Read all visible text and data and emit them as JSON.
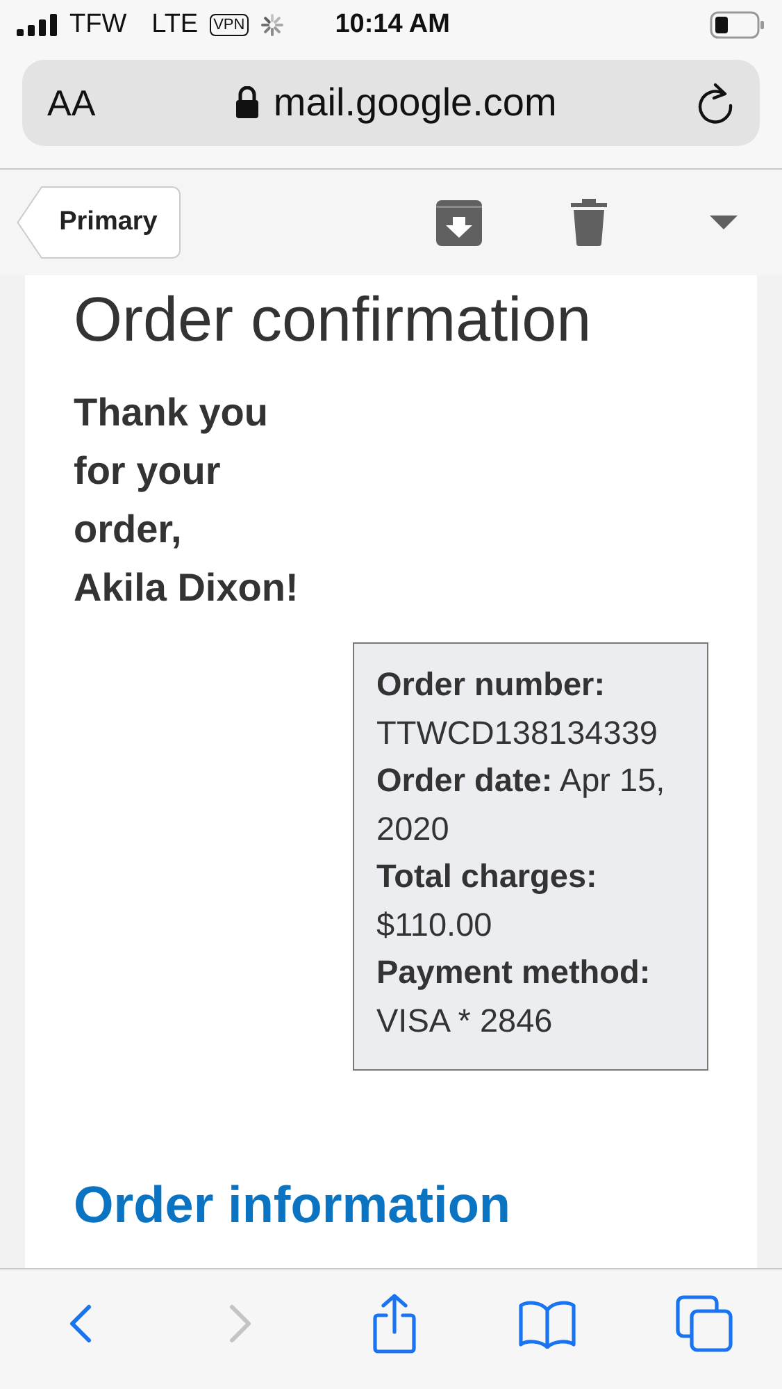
{
  "status_bar": {
    "carrier": "TFW",
    "network": "LTE",
    "vpn": "VPN",
    "time": "10:14 AM"
  },
  "address_bar": {
    "text_size": "AA",
    "url": "mail.google.com"
  },
  "mail_toolbar": {
    "back_label": "Primary"
  },
  "email": {
    "title": "Order confirmation",
    "greeting_lines": [
      "Thank you",
      "for your",
      "order,",
      "Akila Dixon!"
    ],
    "details": [
      "**Order number:** TTWCD138134339",
      "**Order date:** Apr 15, 2020",
      "**Total charges:** $110.00",
      "**Payment method:** VISA * 2846"
    ],
    "section_title": "Order information"
  },
  "browser_toolbar": {
    "back_disabled": false,
    "forward_disabled": true
  }
}
